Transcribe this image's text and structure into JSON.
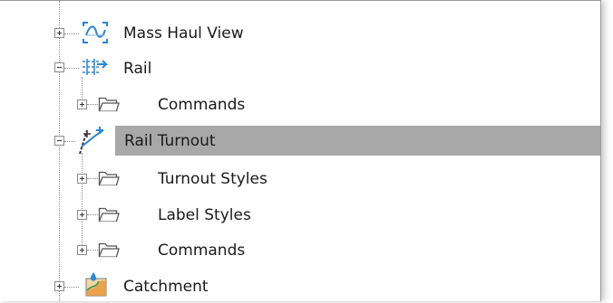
{
  "tree": {
    "items": [
      {
        "label": "Mass Haul View",
        "icon": "mass-haul-view-icon",
        "expander": "plus"
      },
      {
        "label": "Rail",
        "icon": "rail-icon",
        "expander": "minus"
      },
      {
        "label": "Commands",
        "icon": "folder-icon",
        "expander": "plus"
      },
      {
        "label": "Rail Turnout",
        "icon": "rail-turnout-icon",
        "expander": "minus",
        "selected": true
      },
      {
        "label": "Turnout Styles",
        "icon": "folder-icon",
        "expander": "plus"
      },
      {
        "label": "Label Styles",
        "icon": "folder-icon",
        "expander": "plus"
      },
      {
        "label": "Commands",
        "icon": "folder-icon",
        "expander": "plus"
      },
      {
        "label": "Catchment",
        "icon": "catchment-icon",
        "expander": "plus"
      }
    ]
  },
  "colors": {
    "selection": "#a8a8a8",
    "folder_stroke": "#555555",
    "icon_blue": "#2b86d6",
    "catchment_orange": "#e8963a"
  }
}
